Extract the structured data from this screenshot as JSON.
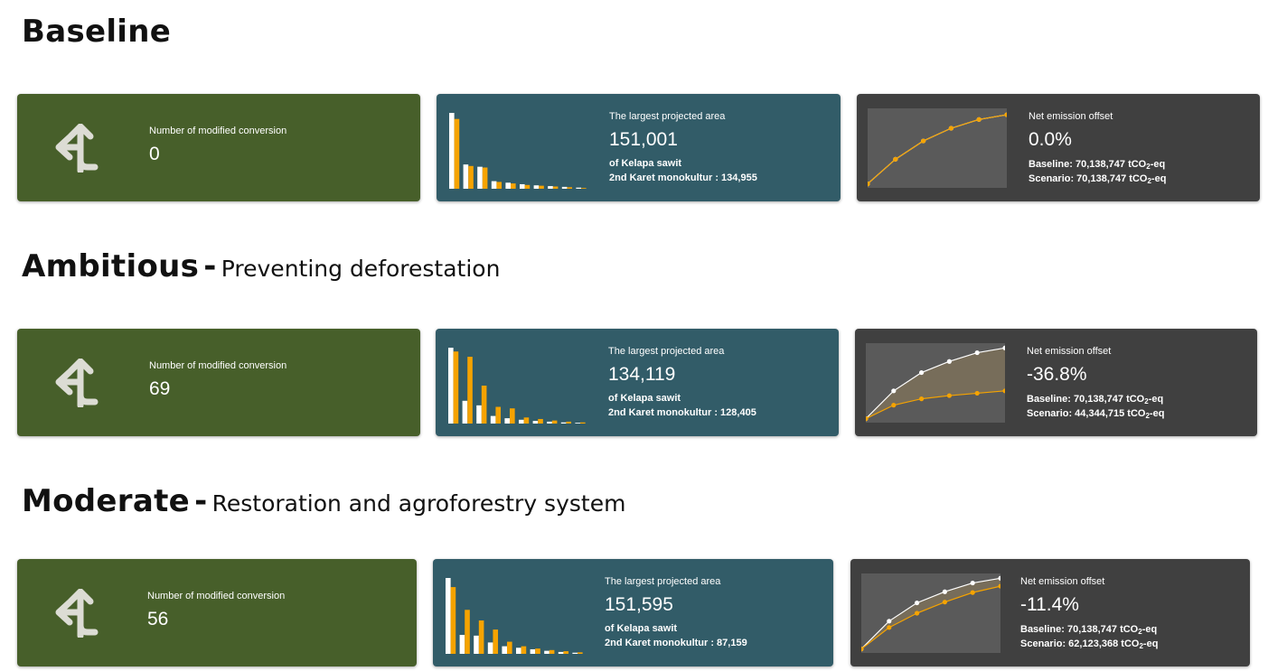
{
  "colors": {
    "green_card": "#475f2a",
    "teal_card": "#325c68",
    "dark_card": "#404040",
    "bar_orange": "#f5a300",
    "bar_white": "#ffffff",
    "chart_bg": "#5a5a5a"
  },
  "icons": {
    "conversion": "split-arrow-icon"
  },
  "scenarios": [
    {
      "title": "Baseline",
      "dash": "",
      "subtitle": "",
      "conversion_label": "Number of modified conversion",
      "conversion_value": "0",
      "area_label": "The largest projected area",
      "area_value": "151,001",
      "area_first": "of Kelapa sawit",
      "area_second": "2nd Karet monokultur : 134,955",
      "emission_label": "Net emission offset",
      "emission_value": "0.0%",
      "baseline_text": "Baseline: 70,138,747 tCO",
      "scenario_text": "Scenario: 70,138,747 tCO",
      "unit_sub": "2",
      "unit_suffix": "-eq"
    },
    {
      "title": "Ambitious",
      "dash": "-",
      "subtitle": "Preventing deforestation",
      "conversion_label": "Number of modified conversion",
      "conversion_value": "69",
      "area_label": "The largest projected area",
      "area_value": "134,119",
      "area_first": "of Kelapa sawit",
      "area_second": "2nd Karet monokultur : 128,405",
      "emission_label": "Net emission offset",
      "emission_value": "-36.8%",
      "baseline_text": "Baseline: 70,138,747 tCO",
      "scenario_text": "Scenario: 44,344,715 tCO",
      "unit_sub": "2",
      "unit_suffix": "-eq"
    },
    {
      "title": "Moderate",
      "dash": "-",
      "subtitle": "Restoration and agroforestry system",
      "conversion_label": "Number of modified conversion",
      "conversion_value": "56",
      "area_label": "The largest projected area",
      "area_value": "151,595",
      "area_first": "of Kelapa sawit",
      "area_second": "2nd Karet monokultur : 87,159",
      "emission_label": "Net emission offset",
      "emission_value": "-11.4%",
      "baseline_text": "Baseline: 70,138,747 tCO",
      "scenario_text": "Scenario: 62,123,368 tCO",
      "unit_sub": "2",
      "unit_suffix": "-eq"
    }
  ],
  "chart_data": [
    {
      "type": "bar",
      "series": [
        {
          "values": [
            1.0,
            0.32,
            0.29,
            0.1,
            0.08,
            0.06,
            0.045,
            0.035,
            0.025,
            0.015
          ]
        },
        {
          "values": [
            0.92,
            0.3,
            0.28,
            0.09,
            0.07,
            0.05,
            0.04,
            0.03,
            0.02,
            0.01
          ]
        }
      ]
    },
    {
      "type": "bar",
      "series": [
        {
          "values": [
            1.0,
            0.3,
            0.24,
            0.1,
            0.07,
            0.05,
            0.035,
            0.025,
            0.015,
            0.01
          ]
        },
        {
          "values": [
            0.95,
            0.88,
            0.5,
            0.22,
            0.2,
            0.08,
            0.06,
            0.04,
            0.025,
            0.015
          ]
        }
      ]
    },
    {
      "type": "bar",
      "series": [
        {
          "values": [
            1.0,
            0.25,
            0.24,
            0.15,
            0.1,
            0.08,
            0.06,
            0.04,
            0.025,
            0.015
          ]
        },
        {
          "values": [
            0.88,
            0.58,
            0.44,
            0.32,
            0.16,
            0.1,
            0.07,
            0.05,
            0.035,
            0.02
          ]
        }
      ]
    },
    {
      "type": "line",
      "series": [
        {
          "values": [
            0.05,
            0.36,
            0.59,
            0.75,
            0.86,
            0.92
          ]
        },
        {
          "values": [
            0.05,
            0.36,
            0.59,
            0.75,
            0.86,
            0.92
          ]
        }
      ]
    },
    {
      "type": "line",
      "series": [
        {
          "values": [
            0.05,
            0.4,
            0.63,
            0.77,
            0.88,
            0.94
          ]
        },
        {
          "values": [
            0.05,
            0.22,
            0.3,
            0.34,
            0.37,
            0.4
          ]
        }
      ]
    },
    {
      "type": "line",
      "series": [
        {
          "values": [
            0.05,
            0.4,
            0.63,
            0.77,
            0.88,
            0.94
          ]
        },
        {
          "values": [
            0.05,
            0.32,
            0.5,
            0.64,
            0.76,
            0.84
          ]
        }
      ]
    }
  ]
}
